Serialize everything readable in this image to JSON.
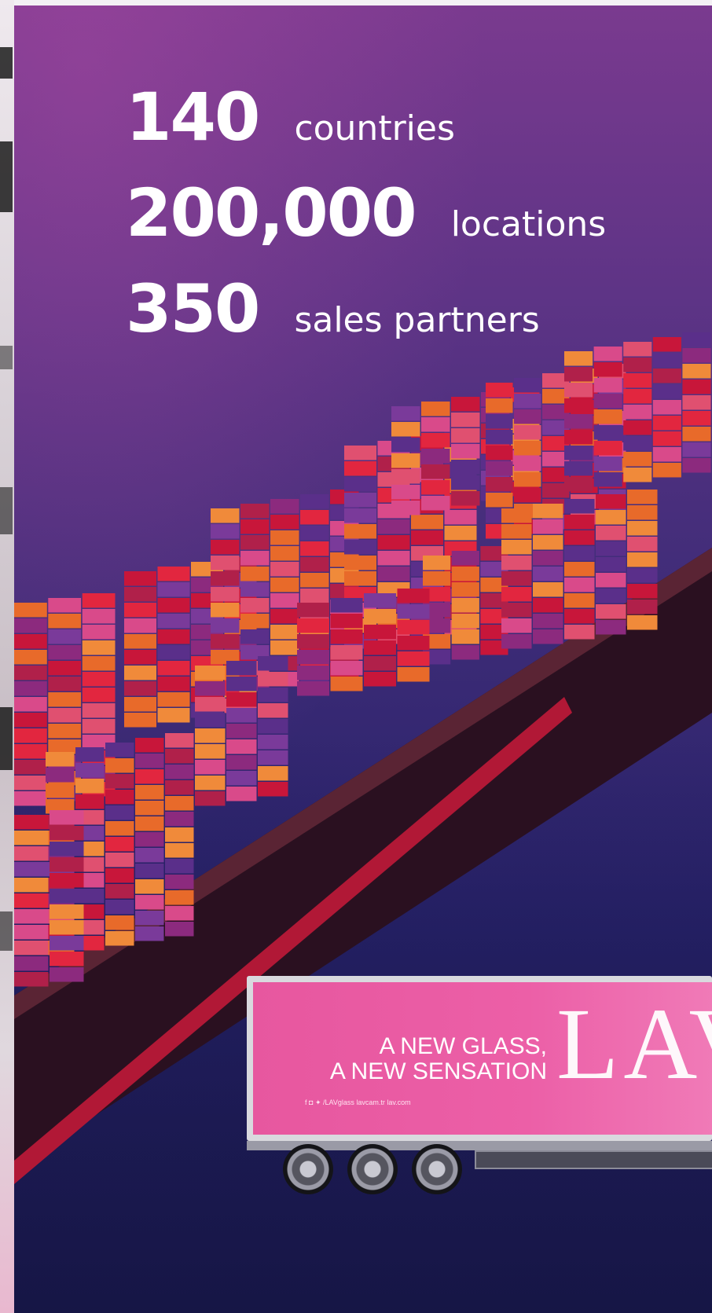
{
  "stats": [
    {
      "number": "140",
      "label": "countries"
    },
    {
      "number": "200,000",
      "label": "locations"
    },
    {
      "number": "350",
      "label": "sales partners"
    }
  ],
  "trailer": {
    "slogan": "A NEW GLASS,\nA NEW SENSATION",
    "social": "f ◘ ✦ /LAVglass   lavcam.tr   lav.com"
  },
  "colors": {
    "sky_top": "#7a3a8f",
    "sea_bottom": "#1c1c55",
    "trailer_pink": "#ec5fa7",
    "text": "#ffffff"
  }
}
